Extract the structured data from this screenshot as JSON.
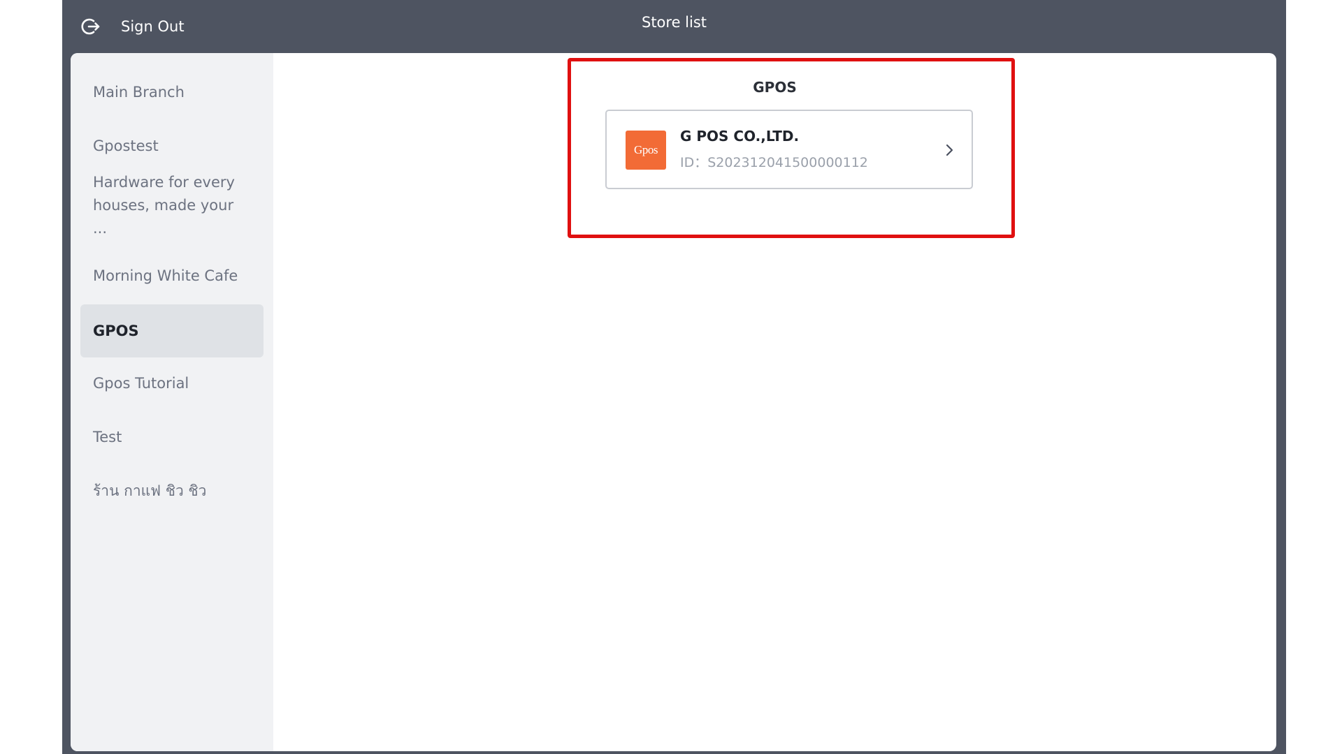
{
  "header": {
    "sign_out_label": "Sign Out",
    "sign_out_icon": "sign-out-icon",
    "title": "Store list"
  },
  "sidebar": {
    "items": [
      {
        "label": "Main Branch",
        "active": false
      },
      {
        "label": "Gpostest",
        "active": false
      },
      {
        "label": "Hardware for every houses, made your ...",
        "active": false
      },
      {
        "label": "Morning White Cafe",
        "active": false
      },
      {
        "label": "GPOS",
        "active": true
      },
      {
        "label": "Gpos Tutorial",
        "active": false
      },
      {
        "label": "Test",
        "active": false
      },
      {
        "label": "ร้าน กาแฟ ชิว ชิว",
        "active": false
      }
    ]
  },
  "main": {
    "title": "GPOS",
    "store": {
      "logo_text": "Gpos",
      "name": "G POS CO.,LTD.",
      "id_prefix": "ID：",
      "id": "S202312041500000112",
      "chevron_icon": "chevron-right-icon"
    }
  },
  "colors": {
    "header_bg": "#4e5461",
    "sidebar_bg": "#f1f2f4",
    "active_item_bg": "#dfe2e6",
    "logo_bg": "#f26b36",
    "highlight_border": "#e01010"
  }
}
